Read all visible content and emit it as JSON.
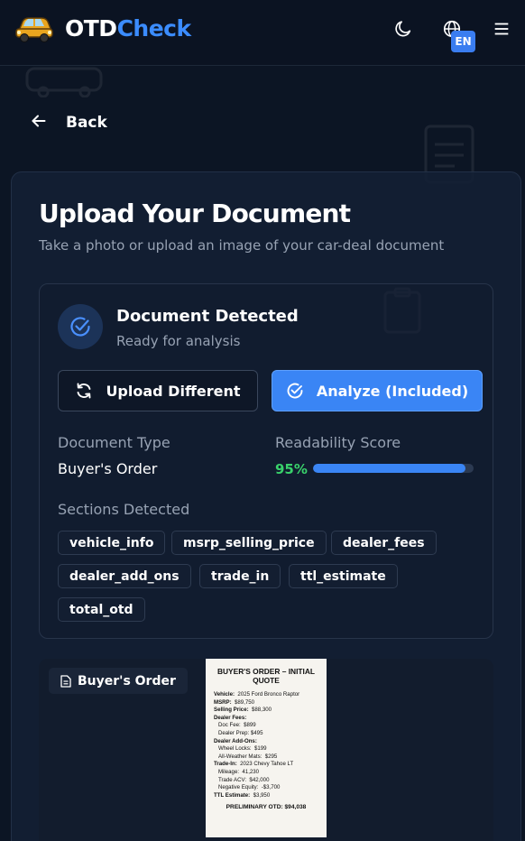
{
  "header": {
    "brand_part1": "OTD",
    "brand_part2": "Check",
    "language_badge": "EN"
  },
  "nav": {
    "back_label": "Back"
  },
  "page": {
    "title": "Upload Your Document",
    "subtitle": "Take a photo or upload an image of your car-deal document"
  },
  "status": {
    "title": "Document Detected",
    "subtitle": "Ready for analysis"
  },
  "actions": {
    "upload_label": "Upload Different",
    "analyze_label": "Analyze (Included)"
  },
  "details": {
    "doc_type_label": "Document Type",
    "doc_type_value": "Buyer's Order",
    "readability_label": "Readability Score",
    "readability_text": "95%",
    "readability_fraction": 0.95,
    "sections_label": "Sections Detected",
    "sections": [
      "vehicle_info",
      "msrp_selling_price",
      "dealer_fees",
      "dealer_add_ons",
      "trade_in",
      "ttl_estimate",
      "total_otd"
    ]
  },
  "preview": {
    "tag_label": "Buyer's Order",
    "doc_title": "BUYER'S ORDER – INITIAL QUOTE",
    "lines": [
      {
        "k": "Vehicle:",
        "v": "2025 Ford Bronco Raptor",
        "ind": false
      },
      {
        "k": "MSRP:",
        "v": "$89,750",
        "ind": false
      },
      {
        "k": "Selling Price:",
        "v": "$88,300",
        "ind": false
      },
      {
        "k": "Dealer Fees:",
        "v": "",
        "ind": false
      },
      {
        "k": "",
        "v": "Doc Fee:  $899",
        "ind": true
      },
      {
        "k": "",
        "v": "Dealer Prep: $495",
        "ind": true
      },
      {
        "k": "Dealer Add-Ons:",
        "v": "",
        "ind": false
      },
      {
        "k": "",
        "v": "Wheel Locks:  $199",
        "ind": true
      },
      {
        "k": "",
        "v": "All-Weather Mats:  $295",
        "ind": true
      },
      {
        "k": "Trade-In:",
        "v": "2023 Chevy Tahoe LT",
        "ind": false
      },
      {
        "k": "",
        "v": "Mileage:  41,230",
        "ind": true
      },
      {
        "k": "",
        "v": "Trade ACV:  $42,000",
        "ind": true
      },
      {
        "k": "",
        "v": "Negative Equity:  -$3,700",
        "ind": true
      },
      {
        "k": "TTL Estimate:",
        "v": "$3,950",
        "ind": false
      }
    ],
    "otd": "PRELIMINARY OTD: $94,038"
  },
  "colors": {
    "accent": "#3a85f5",
    "brand_blue": "#3b8cff",
    "success": "#39d16b",
    "background": "#0c1524"
  },
  "icons": {
    "logo": "car-logo-icon",
    "theme": "moon-icon",
    "language": "globe-icon",
    "menu": "hamburger-icon",
    "back": "arrow-left-icon",
    "detected": "check-circle-icon",
    "upload": "refresh-icon",
    "analyze": "check-circle-icon",
    "preview_tag": "document-icon"
  }
}
